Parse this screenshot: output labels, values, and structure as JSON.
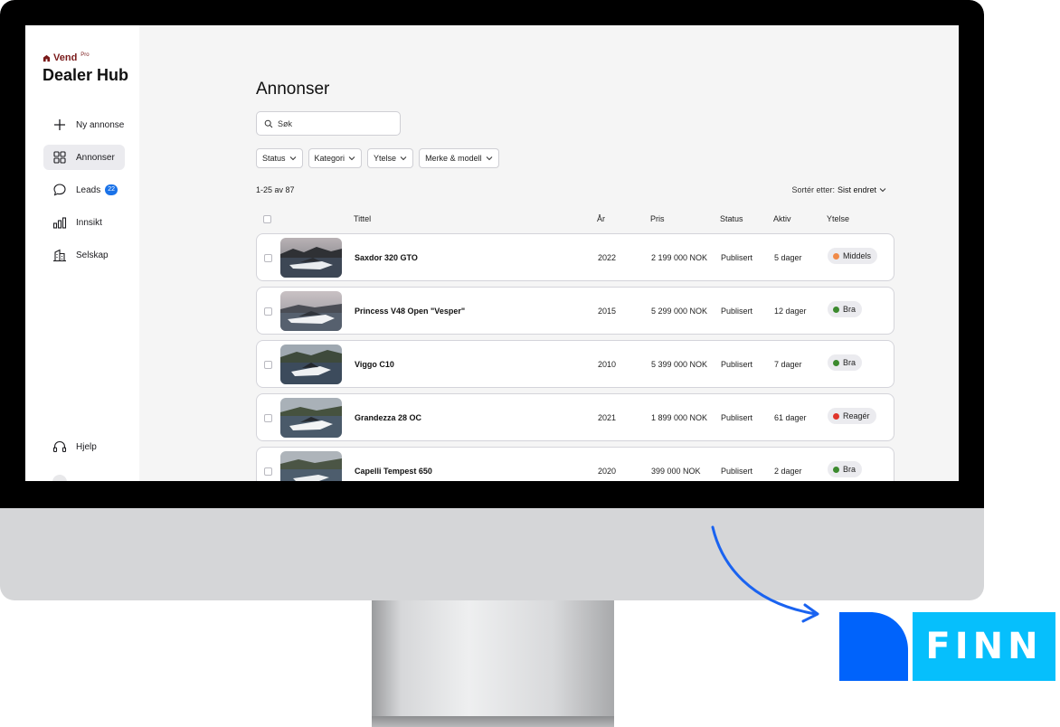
{
  "brand": {
    "name": "Vend",
    "tier": "Pro",
    "color": "#7a1a1a"
  },
  "app_title": "Dealer Hub",
  "sidebar": {
    "items": [
      {
        "label": "Ny annonse",
        "icon": "plus-icon"
      },
      {
        "label": "Annonser",
        "icon": "grid-icon",
        "active": true
      },
      {
        "label": "Leads",
        "icon": "chat-bubble-icon",
        "badge": "22"
      },
      {
        "label": "Innsikt",
        "icon": "bar-chart-icon"
      },
      {
        "label": "Selskap",
        "icon": "building-icon"
      }
    ],
    "help": {
      "label": "Hjelp",
      "icon": "headset-icon"
    }
  },
  "main": {
    "title": "Annonser",
    "search_placeholder": "Søk",
    "filters": [
      "Status",
      "Kategori",
      "Ytelse",
      "Merke & modell"
    ],
    "count": "1-25 av 87",
    "sort": {
      "label": "Sortér etter:",
      "value": "Sist endret"
    },
    "columns": {
      "title": "Tittel",
      "year": "År",
      "price": "Pris",
      "status": "Status",
      "active": "Aktiv",
      "performance": "Ytelse"
    },
    "rows": [
      {
        "title": "Saxdor 320 GTO",
        "year": "2022",
        "price": "2 199 000 NOK",
        "status": "Publisert",
        "active": "5 dager",
        "performance": "Middels",
        "perf_color": "#f08a48"
      },
      {
        "title": "Princess V48 Open \"Vesper\"",
        "year": "2015",
        "price": "5 299 000 NOK",
        "status": "Publisert",
        "active": "12 dager",
        "performance": "Bra",
        "perf_color": "#3c8a2e"
      },
      {
        "title": "Viggo C10",
        "year": "2010",
        "price": "5 399 000 NOK",
        "status": "Publisert",
        "active": "7 dager",
        "performance": "Bra",
        "perf_color": "#3c8a2e"
      },
      {
        "title": "Grandezza 28 OC",
        "year": "2021",
        "price": "1 899 000 NOK",
        "status": "Publisert",
        "active": "61 dager",
        "performance": "Reagér",
        "perf_color": "#e0352b"
      },
      {
        "title": "Capelli Tempest 650",
        "year": "2020",
        "price": "399 000 NOK",
        "status": "Publisert",
        "active": "2 dager",
        "performance": "Bra",
        "perf_color": "#3c8a2e"
      }
    ]
  },
  "finn": {
    "logo_text": "FINN",
    "mark_color": "#0063fb",
    "box_color": "#06bffc"
  },
  "colors": {
    "accent": "#1a72e8",
    "arrow": "#1a63f0"
  }
}
